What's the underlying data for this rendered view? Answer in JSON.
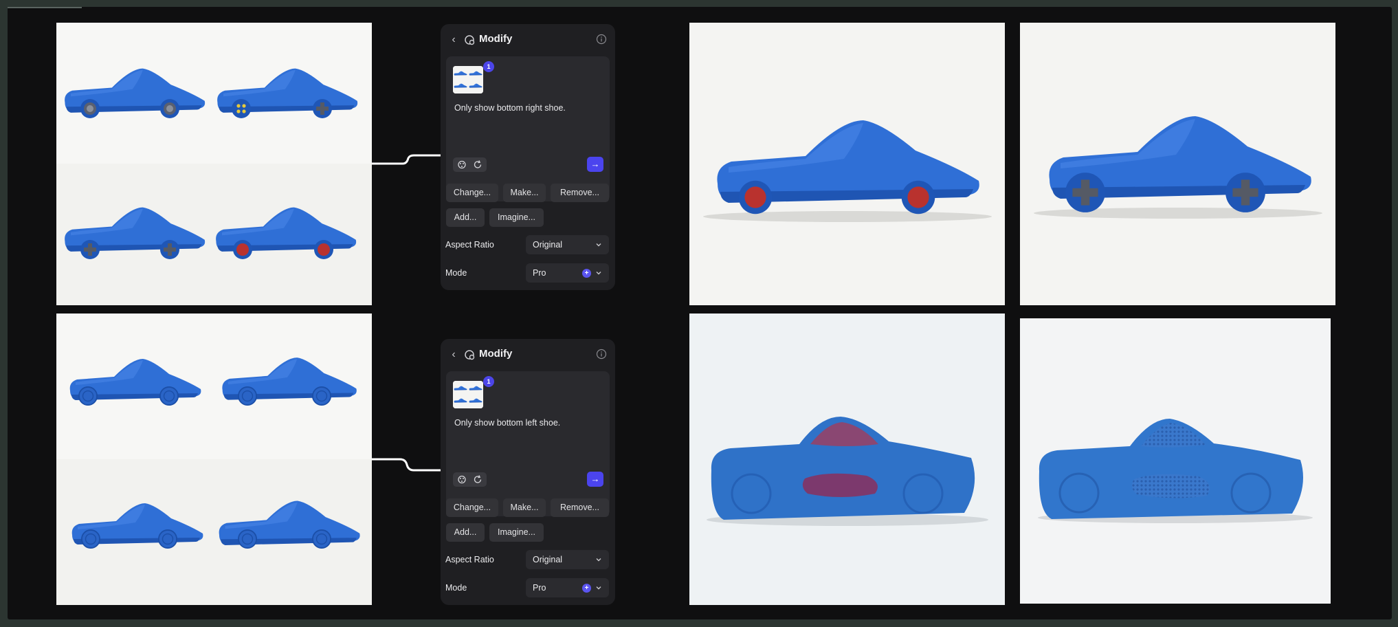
{
  "panels": [
    {
      "title": "Modify",
      "badge": "1",
      "prompt": "Only show bottom right shoe.",
      "chips": [
        "Change...",
        "Make...",
        "Remove...",
        "Add...",
        "Imagine..."
      ],
      "aspect_ratio_label": "Aspect Ratio",
      "aspect_ratio_value": "Original",
      "mode_label": "Mode",
      "mode_value": "Pro"
    },
    {
      "title": "Modify",
      "badge": "1",
      "prompt": "Only show bottom left shoe.",
      "chips": [
        "Change...",
        "Make...",
        "Remove...",
        "Add...",
        "Imagine..."
      ],
      "aspect_ratio_label": "Aspect Ratio",
      "aspect_ratio_value": "Original",
      "mode_label": "Mode",
      "mode_value": "Pro"
    }
  ],
  "icons": {
    "back": "chevron-left-icon",
    "modify": "modify-icon",
    "info": "info-icon",
    "send": "arrow-right-icon",
    "chevron": "chevron-down-icon"
  },
  "colors": {
    "accent": "#4b44ee",
    "shoe_blue": "#2f6fd6",
    "panel_bg": "#1f1f22",
    "canvas_bg": "#0f0f10"
  }
}
